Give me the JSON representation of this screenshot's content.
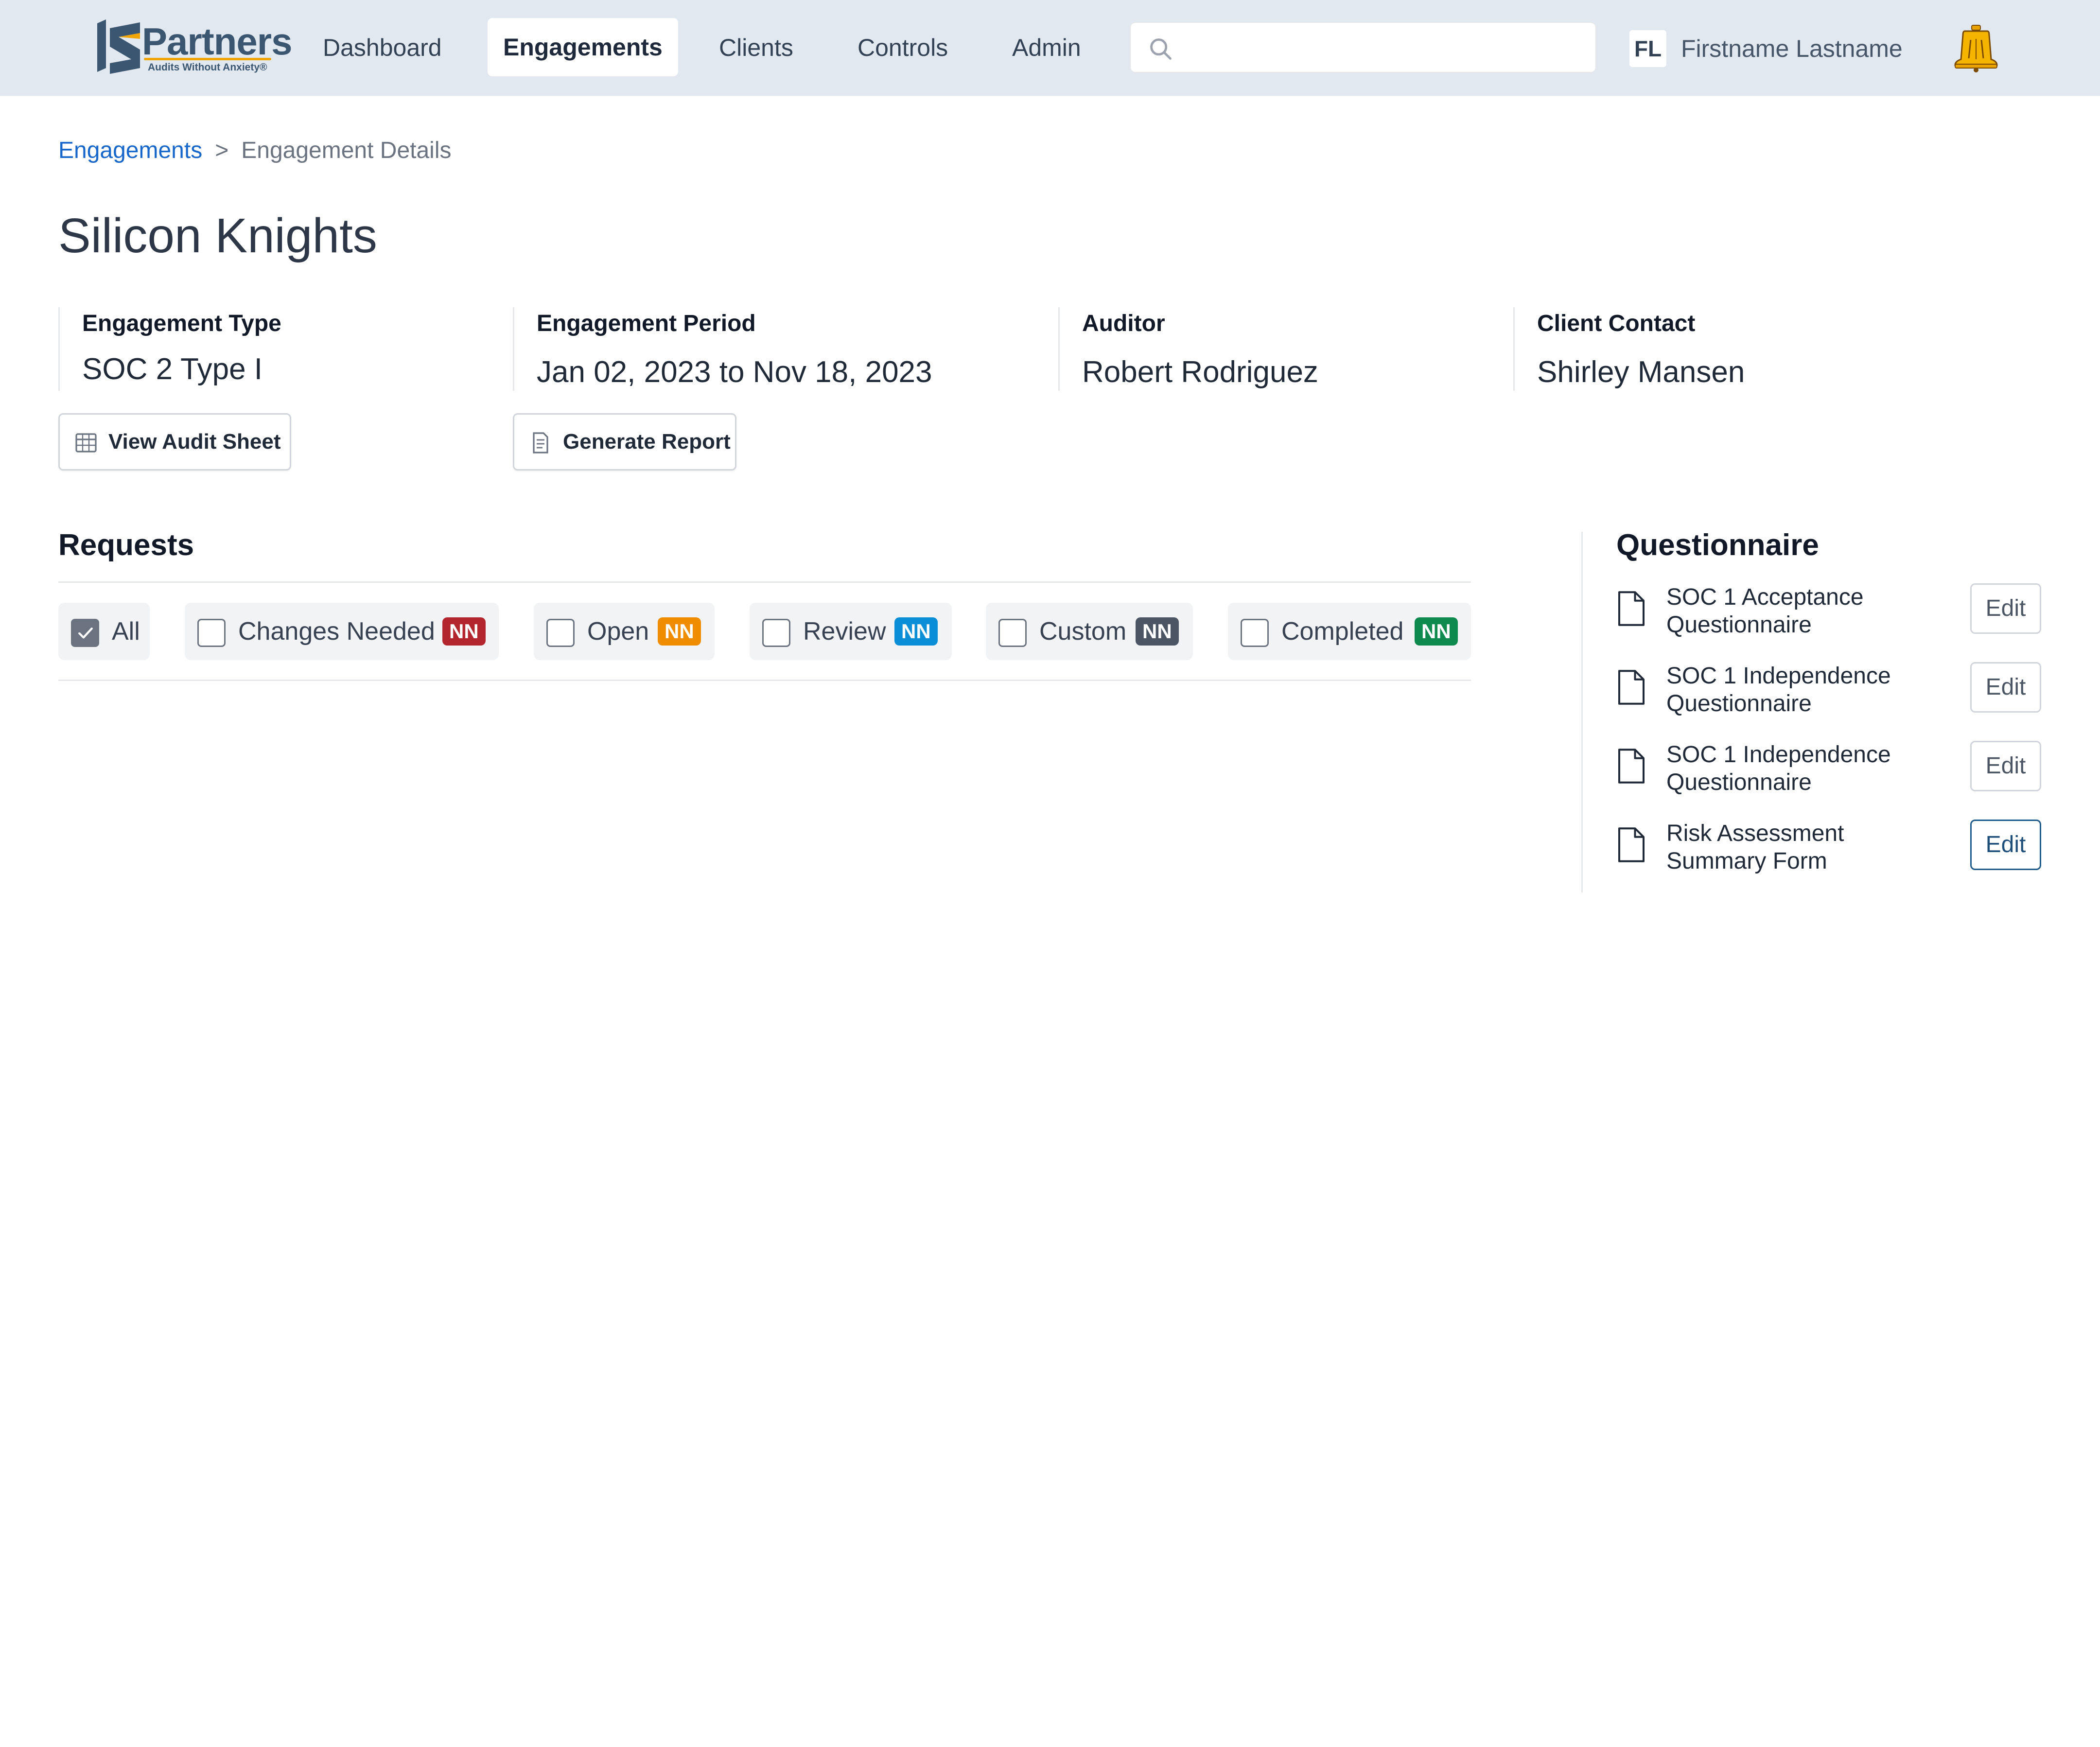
{
  "app": {
    "logo_word": "Partners",
    "logo_tagline": "Audits Without Anxiety®",
    "nav": [
      {
        "label": "Dashboard"
      },
      {
        "label": "Engagements",
        "active": true
      },
      {
        "label": "Clients"
      },
      {
        "label": "Controls"
      },
      {
        "label": "Admin"
      }
    ],
    "search": {
      "placeholder": "",
      "value": ""
    },
    "user": {
      "initials": "FL",
      "name": "Firstname Lastname"
    }
  },
  "breadcrumb": {
    "parent": "Engagements",
    "separator": ">",
    "current": "Engagement Details"
  },
  "page": {
    "title": "Silicon Knights"
  },
  "fields": {
    "engagement_type": {
      "label": "Engagement Type",
      "value": "SOC 2 Type I"
    },
    "engagement_period": {
      "label": "Engagement Period",
      "value": "Jan 02, 2023 to Nov 18, 2023"
    },
    "auditor": {
      "label": "Auditor",
      "value": "Robert Rodriguez"
    },
    "client_contact": {
      "label": "Client Contact",
      "value": "Shirley Mansen"
    }
  },
  "actions": {
    "view_audit_sheet": "View Audit Sheet",
    "generate_report": "Generate Report"
  },
  "requests": {
    "title": "Requests",
    "filters": [
      {
        "label": "All",
        "checked": true
      },
      {
        "label": "Changes Needed",
        "checked": false,
        "badge": "NN",
        "badge_color": "#b3262d"
      },
      {
        "label": "Open",
        "checked": false,
        "badge": "NN",
        "badge_color": "#ef8c00"
      },
      {
        "label": "Review",
        "checked": false,
        "badge": "NN",
        "badge_color": "#0a8fd6"
      },
      {
        "label": "Custom",
        "checked": false,
        "badge": "NN",
        "badge_color": "#4b5563"
      },
      {
        "label": "Completed",
        "checked": false,
        "badge": "NN",
        "badge_color": "#0e8a4f"
      }
    ]
  },
  "questionnaire": {
    "title": "Questionnaire",
    "items": [
      {
        "line1": "SOC 1 Acceptance",
        "line2": "Questionnaire",
        "action": "Edit"
      },
      {
        "line1": "SOC 1 Independence",
        "line2": "Questionnaire",
        "action": "Edit"
      },
      {
        "line1": "SOC 1 Independence",
        "line2": "Questionnaire",
        "action": "Edit"
      },
      {
        "line1": "Risk Assessment",
        "line2": "Summary Form",
        "action": "Edit"
      }
    ]
  },
  "colors": {
    "nav_bg": "#e2e8f0",
    "link": "#1766c9",
    "logo_text": "#3b5670",
    "logo_accent": "#f0a500"
  }
}
